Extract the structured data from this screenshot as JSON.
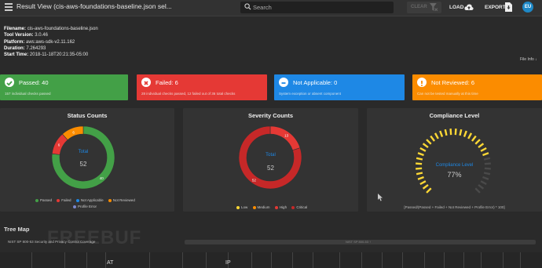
{
  "header": {
    "title": "Result View (cis-aws-foundations-baseline.json sel...",
    "search_placeholder": "Search",
    "clear_label": "CLEAR",
    "load_label": "LOAD",
    "export_label": "EXPORT",
    "avatar_initials": "EU"
  },
  "meta": [
    {
      "label": "Filename:",
      "value": "cis-aws-foundations-baseline.json"
    },
    {
      "label": "Tool Version:",
      "value": "3.0.46"
    },
    {
      "label": "Platform:",
      "value": "aws:aws-sdk-v2.11.162"
    },
    {
      "label": "Duration:",
      "value": "7.264293"
    },
    {
      "label": "Start Time:",
      "value": "2018-11-18T20:21:35-05:00"
    }
  ],
  "file_info_label": "File Info ↓",
  "status_cards": [
    {
      "title": "Passed: 40",
      "subtitle": "157 individual checks passed",
      "color": "#43a047",
      "icon": "check-circle-icon"
    },
    {
      "title": "Failed: 6",
      "subtitle": "28 individual checks passed, 12 failed out of 36 total checks",
      "color": "#e53935",
      "icon": "x-circle-icon"
    },
    {
      "title": "Not Applicable: 0",
      "subtitle": "System exception or absent component",
      "color": "#1e88e5",
      "icon": "minus-circle-icon"
    },
    {
      "title": "Not Reviewed: 6",
      "subtitle": "Can not be tested manually at this time",
      "color": "#fb8c00",
      "icon": "exclamation-circle-icon"
    }
  ],
  "status_counts": {
    "title": "Status Counts",
    "center_label": "Total",
    "center_value": "52",
    "legend": [
      {
        "label": "Passed",
        "color": "#43a047"
      },
      {
        "label": "Failed",
        "color": "#e53935"
      },
      {
        "label": "Not Applicable",
        "color": "#1e88e5"
      },
      {
        "label": "Not Reviewed",
        "color": "#fb8c00"
      },
      {
        "label": "Profile Error",
        "color": "#7986cb"
      }
    ]
  },
  "severity_counts": {
    "title": "Severity Counts",
    "center_label": "Total",
    "center_value": "52",
    "legend": [
      {
        "label": "Low",
        "color": "#fdd835"
      },
      {
        "label": "Medium",
        "color": "#fb8c00"
      },
      {
        "label": "High",
        "color": "#e53935"
      },
      {
        "label": "Critical",
        "color": "#c62828"
      }
    ]
  },
  "compliance": {
    "title": "Compliance Level",
    "label": "Compliance Level",
    "value": "77%",
    "formula": "[Passed/(Passed + Failed + Not Reviewed + Profile Error) * 100]"
  },
  "treemap": {
    "title": "Tree Map",
    "subtitle": "NIST SP 800-53 Security and Privacy Control Coverage",
    "bar_label": "NIST SP 800-53 ↑",
    "labels": [
      "AT",
      "IP"
    ]
  },
  "watermark": "FREEBUF",
  "chart_data": [
    {
      "type": "pie",
      "title": "Status Counts",
      "categories": [
        "Passed",
        "Failed",
        "Not Applicable",
        "Not Reviewed",
        "Profile Error"
      ],
      "values": [
        40,
        6,
        0,
        6,
        0
      ],
      "colors": [
        "#43a047",
        "#e53935",
        "#1e88e5",
        "#fb8c00",
        "#7986cb"
      ],
      "total": 52
    },
    {
      "type": "pie",
      "title": "Severity Counts",
      "categories": [
        "Low",
        "Medium",
        "High",
        "Critical"
      ],
      "values": [
        0,
        0,
        13,
        52
      ],
      "colors": [
        "#fdd835",
        "#fb8c00",
        "#e53935",
        "#c62828"
      ],
      "data_labels": [
        "",
        "",
        "13",
        "52"
      ]
    },
    {
      "type": "gauge",
      "title": "Compliance Level",
      "value_percent": 77
    }
  ]
}
